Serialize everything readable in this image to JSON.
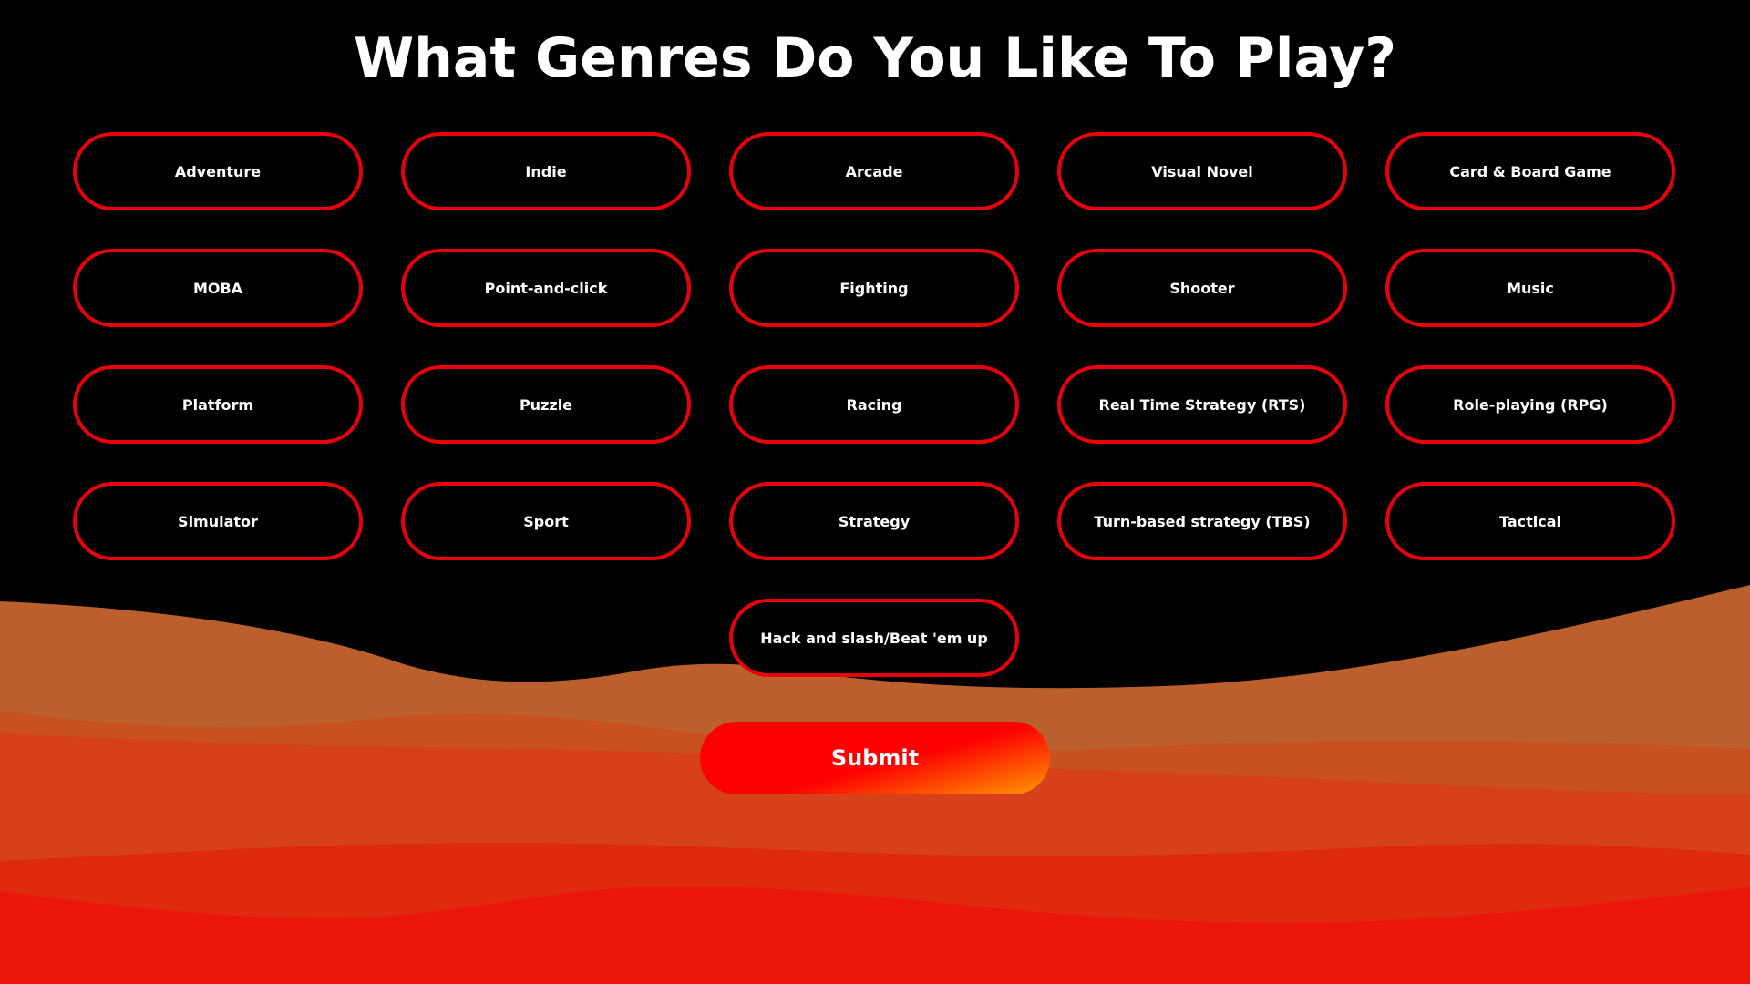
{
  "page": {
    "title": "What Genres Do You Like To Play?"
  },
  "genres": [
    "Adventure",
    "Indie",
    "Arcade",
    "Visual Novel",
    "Card & Board Game",
    "MOBA",
    "Point-and-click",
    "Fighting",
    "Shooter",
    "Music",
    "Platform",
    "Puzzle",
    "Racing",
    "Real Time Strategy (RTS)",
    "Role-playing (RPG)",
    "Simulator",
    "Sport",
    "Strategy",
    "Turn-based strategy (TBS)",
    "Tactical",
    "Hack and slash/Beat 'em up"
  ],
  "actions": {
    "submit_label": "Submit"
  },
  "colors": {
    "background": "#000000",
    "button_border": "#e8000b",
    "submit_gradient_start": "#ff0000",
    "submit_gradient_end": "#ff9a00",
    "wave_1": "#bb5f2c",
    "wave_2": "#c9501f",
    "wave_3": "#d6401a",
    "wave_4": "#e02a10",
    "wave_5": "#ec160a"
  }
}
